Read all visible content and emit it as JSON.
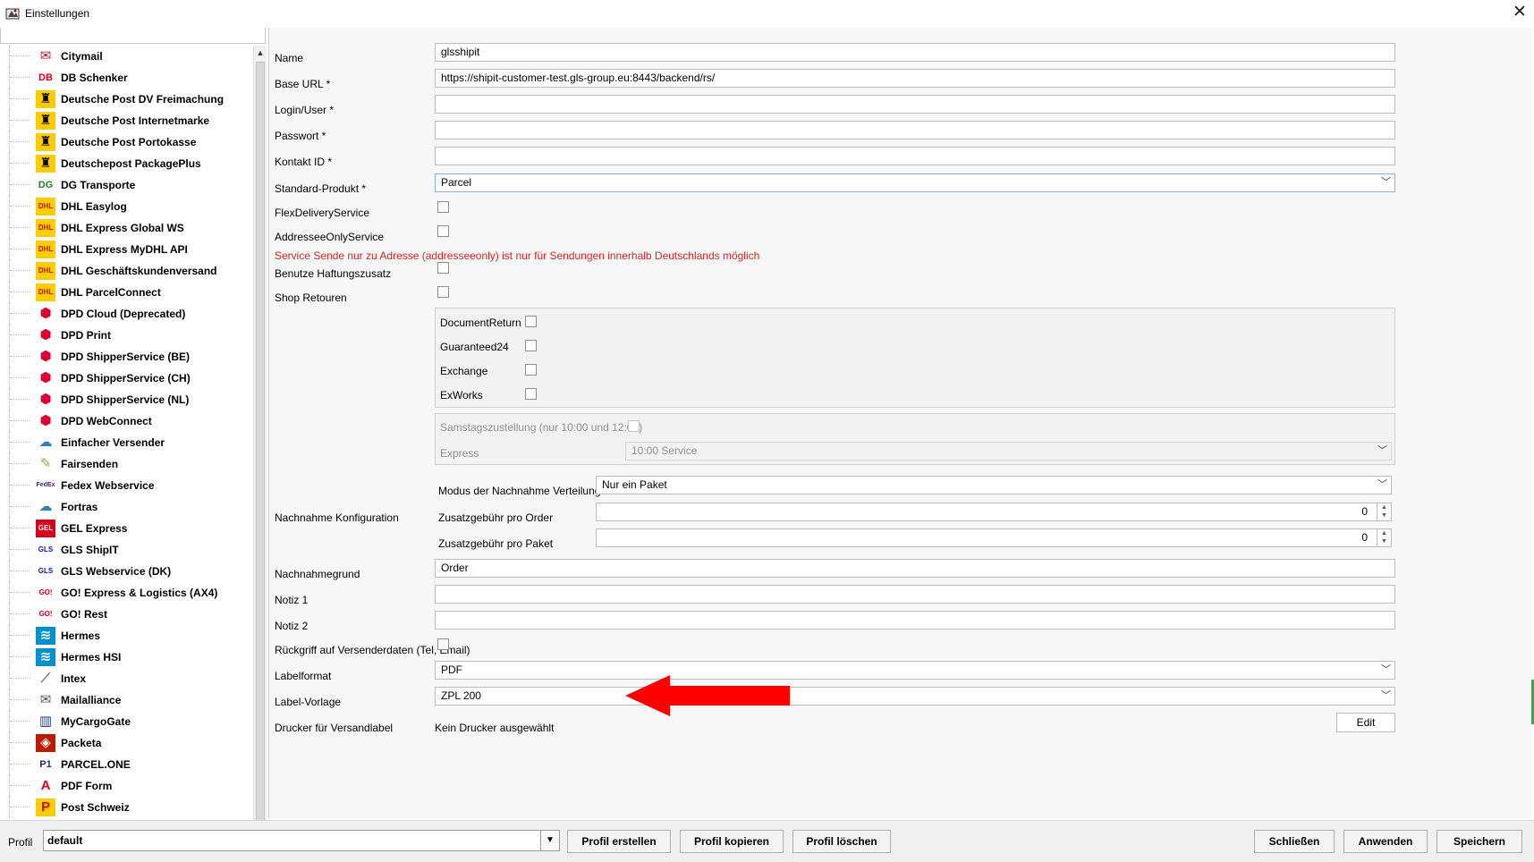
{
  "window": {
    "title": "Einstellungen",
    "close_glyph": "✕"
  },
  "carriers": [
    {
      "label": "Citymail",
      "icon": "mail-icon",
      "glyph": "✉",
      "color": "#c4161c",
      "bg": "#fff"
    },
    {
      "label": "DB Schenker",
      "icon": "db-schenker-icon",
      "glyph": "DB",
      "color": "#e2001a",
      "bg": "#fff"
    },
    {
      "label": "Deutsche Post DV Freimachung",
      "icon": "deutsche-post-icon",
      "glyph": "♜",
      "color": "#000",
      "bg": "#ffcc00"
    },
    {
      "label": "Deutsche Post Internetmarke",
      "icon": "deutsche-post-icon",
      "glyph": "♜",
      "color": "#000",
      "bg": "#ffcc00"
    },
    {
      "label": "Deutsche Post Portokasse",
      "icon": "deutsche-post-icon",
      "glyph": "♜",
      "color": "#000",
      "bg": "#ffcc00"
    },
    {
      "label": "Deutschepost PackagePlus",
      "icon": "deutsche-post-icon",
      "glyph": "♜",
      "color": "#000",
      "bg": "#ffcc00"
    },
    {
      "label": "DG Transporte",
      "icon": "dg-transporte-icon",
      "glyph": "DG",
      "color": "#2a7a2a",
      "bg": "#fff"
    },
    {
      "label": "DHL Easylog",
      "icon": "dhl-icon",
      "glyph": "DHL",
      "color": "#d40511",
      "bg": "#ffcc00"
    },
    {
      "label": "DHL Express Global WS",
      "icon": "dhl-icon",
      "glyph": "DHL",
      "color": "#d40511",
      "bg": "#ffcc00"
    },
    {
      "label": "DHL Express MyDHL API",
      "icon": "dhl-icon",
      "glyph": "DHL",
      "color": "#d40511",
      "bg": "#ffcc00"
    },
    {
      "label": "DHL Geschäftskundenversand",
      "icon": "dhl-icon",
      "glyph": "DHL",
      "color": "#d40511",
      "bg": "#ffcc00"
    },
    {
      "label": "DHL ParcelConnect",
      "icon": "dhl-icon",
      "glyph": "DHL",
      "color": "#d40511",
      "bg": "#ffcc00"
    },
    {
      "label": "DPD Cloud (Deprecated)",
      "icon": "dpd-icon",
      "glyph": "⬢",
      "color": "#dc0032",
      "bg": "#fff"
    },
    {
      "label": "DPD Print",
      "icon": "dpd-icon",
      "glyph": "⬢",
      "color": "#dc0032",
      "bg": "#fff"
    },
    {
      "label": "DPD ShipperService (BE)",
      "icon": "dpd-icon",
      "glyph": "⬢",
      "color": "#dc0032",
      "bg": "#fff"
    },
    {
      "label": "DPD ShipperService (CH)",
      "icon": "dpd-icon",
      "glyph": "⬢",
      "color": "#dc0032",
      "bg": "#fff"
    },
    {
      "label": "DPD ShipperService (NL)",
      "icon": "dpd-icon",
      "glyph": "⬢",
      "color": "#dc0032",
      "bg": "#fff"
    },
    {
      "label": "DPD WebConnect",
      "icon": "dpd-icon",
      "glyph": "⬢",
      "color": "#dc0032",
      "bg": "#fff"
    },
    {
      "label": "Einfacher Versender",
      "icon": "cloud-icon",
      "glyph": "☁",
      "color": "#2d7fc1",
      "bg": "#fff"
    },
    {
      "label": "Fairsenden",
      "icon": "leaf-icon",
      "glyph": "✎",
      "color": "#7ab648",
      "bg": "#fff"
    },
    {
      "label": "Fedex Webservice",
      "icon": "fedex-icon",
      "glyph": "FedEx",
      "color": "#4d148c",
      "bg": "#fff"
    },
    {
      "label": "Fortras",
      "icon": "cloud-icon",
      "glyph": "☁",
      "color": "#2d7fc1",
      "bg": "#fff"
    },
    {
      "label": "GEL Express",
      "icon": "gel-express-icon",
      "glyph": "GEL",
      "color": "#fff",
      "bg": "#d6001c"
    },
    {
      "label": "GLS ShipIT",
      "icon": "gls-icon",
      "glyph": "GLS",
      "color": "#061ab1",
      "bg": "#fff"
    },
    {
      "label": "GLS Webservice (DK)",
      "icon": "gls-icon",
      "glyph": "GLS",
      "color": "#061ab1",
      "bg": "#fff"
    },
    {
      "label": "GO! Express & Logistics (AX4)",
      "icon": "go-icon",
      "glyph": "GO!",
      "color": "#e2001a",
      "bg": "#fff"
    },
    {
      "label": "GO! Rest",
      "icon": "go-icon",
      "glyph": "GO!",
      "color": "#e2001a",
      "bg": "#fff"
    },
    {
      "label": "Hermes",
      "icon": "hermes-icon",
      "glyph": "≋",
      "color": "#fff",
      "bg": "#0091cd"
    },
    {
      "label": "Hermes HSI",
      "icon": "hermes-icon",
      "glyph": "≋",
      "color": "#fff",
      "bg": "#0091cd"
    },
    {
      "label": "Intex",
      "icon": "intex-icon",
      "glyph": "⟋",
      "color": "#6a7f94",
      "bg": "#fff"
    },
    {
      "label": "Mailalliance",
      "icon": "envelope-icon",
      "glyph": "✉",
      "color": "#555",
      "bg": "#fff"
    },
    {
      "label": "MyCargoGate",
      "icon": "mycargogate-icon",
      "glyph": "▥",
      "color": "#1d3f8f",
      "bg": "#fff"
    },
    {
      "label": "Packeta",
      "icon": "packeta-icon",
      "glyph": "◈",
      "color": "#fff",
      "bg": "#ba1b02"
    },
    {
      "label": "PARCEL.ONE",
      "icon": "parcel-one-icon",
      "glyph": "P1",
      "color": "#1f2d5c",
      "bg": "#fff"
    },
    {
      "label": "PDF Form",
      "icon": "pdf-icon",
      "glyph": "A",
      "color": "#e2001a",
      "bg": "#fff"
    },
    {
      "label": "Post Schweiz",
      "icon": "post-schweiz-icon",
      "glyph": "P",
      "color": "#d40511",
      "bg": "#ffcc00"
    }
  ],
  "form": {
    "name": {
      "label": "Name",
      "value": "glsshipit"
    },
    "base_url": {
      "label": "Base URL *",
      "value": "https://shipit-customer-test.gls-group.eu:8443/backend/rs/"
    },
    "login": {
      "label": "Login/User *",
      "value": ""
    },
    "password": {
      "label": "Passwort *",
      "value": ""
    },
    "contact_id": {
      "label": "Kontakt ID *",
      "value": ""
    },
    "standard_product": {
      "label": "Standard-Produkt *",
      "value": "Parcel"
    },
    "flex_delivery": {
      "label": "FlexDeliveryService"
    },
    "addressee_only": {
      "label": "AddresseeOnlyService"
    },
    "warning": "Service Sende nur zu Adresse (addresseeonly) ist nur für Sendungen innerhalb Deutschlands möglich",
    "liability": {
      "label": "Benutze Haftungszusatz"
    },
    "shop_returns": {
      "label": "Shop Retouren"
    },
    "services": [
      {
        "label": "DocumentReturn"
      },
      {
        "label": "Guaranteed24"
      },
      {
        "label": "Exchange"
      },
      {
        "label": "ExWorks"
      }
    ],
    "saturday": {
      "label": "Samstagszustellung (nur 10:00 und 12:00)"
    },
    "express": {
      "label": "Express",
      "value": "10:00 Service"
    },
    "cod": {
      "label": "Nachnahme Konfiguration",
      "mode_label": "Modus der Nachnahme Verteilung",
      "mode_value": "Nur ein Paket",
      "fee_order_label": "Zusatzgebühr pro Order",
      "fee_order_value": "0",
      "fee_package_label": "Zusatzgebühr pro Paket",
      "fee_package_value": "0"
    },
    "cod_reason": {
      "label": "Nachnahmegrund",
      "value": "Order"
    },
    "note1": {
      "label": "Notiz 1",
      "value": ""
    },
    "note2": {
      "label": "Notiz 2",
      "value": ""
    },
    "fallback_sender": {
      "label": "Rückgriff auf Versenderdaten (Tel, Email)"
    },
    "label_format": {
      "label": "Labelformat",
      "value": "PDF"
    },
    "label_template": {
      "label": "Label-Vorlage",
      "value": "ZPL 200"
    },
    "printer": {
      "label": "Drucker für Versandlabel",
      "value": "Kein Drucker ausgewählt",
      "edit_label": "Edit"
    }
  },
  "bottom": {
    "profile_label": "Profil",
    "profile_value": "default",
    "create": "Profil erstellen",
    "copy": "Profil kopieren",
    "delete": "Profil löschen",
    "close": "Schließen",
    "apply": "Anwenden",
    "save": "Speichern"
  },
  "annotation": {
    "arrow_color": "#ff0000"
  }
}
